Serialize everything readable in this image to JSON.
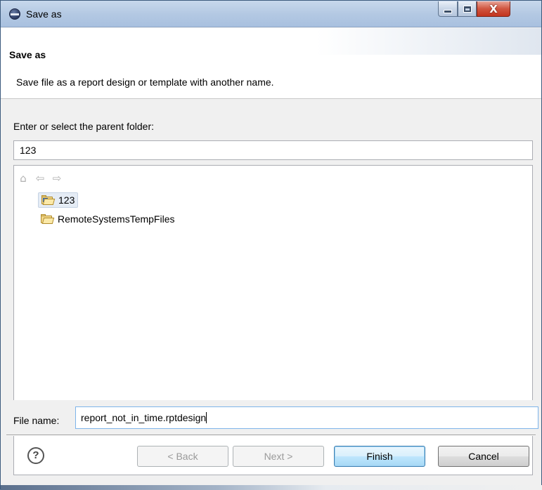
{
  "window": {
    "title": "Save as",
    "controls": {
      "minimize_icon": "minimize-icon",
      "maximize_icon": "maximize-icon",
      "close_label": "X"
    }
  },
  "header": {
    "title": "Save as",
    "description": "Save file as a report design or template with another name."
  },
  "folder": {
    "label": "Enter or select the parent folder:",
    "value": "123",
    "toolbar_icons": [
      "home-icon",
      "back-arrow-icon",
      "forward-arrow-icon"
    ],
    "items": [
      {
        "label": "123",
        "icon": "open-project-folder-icon",
        "selected": true
      },
      {
        "label": "RemoteSystemsTempFiles",
        "icon": "open-folder-icon",
        "selected": false
      }
    ]
  },
  "file": {
    "label": "File name:",
    "value": "report_not_in_time.rptdesign"
  },
  "buttons": {
    "help": "?",
    "back": "< Back",
    "next": "Next >",
    "finish": "Finish",
    "cancel": "Cancel"
  }
}
